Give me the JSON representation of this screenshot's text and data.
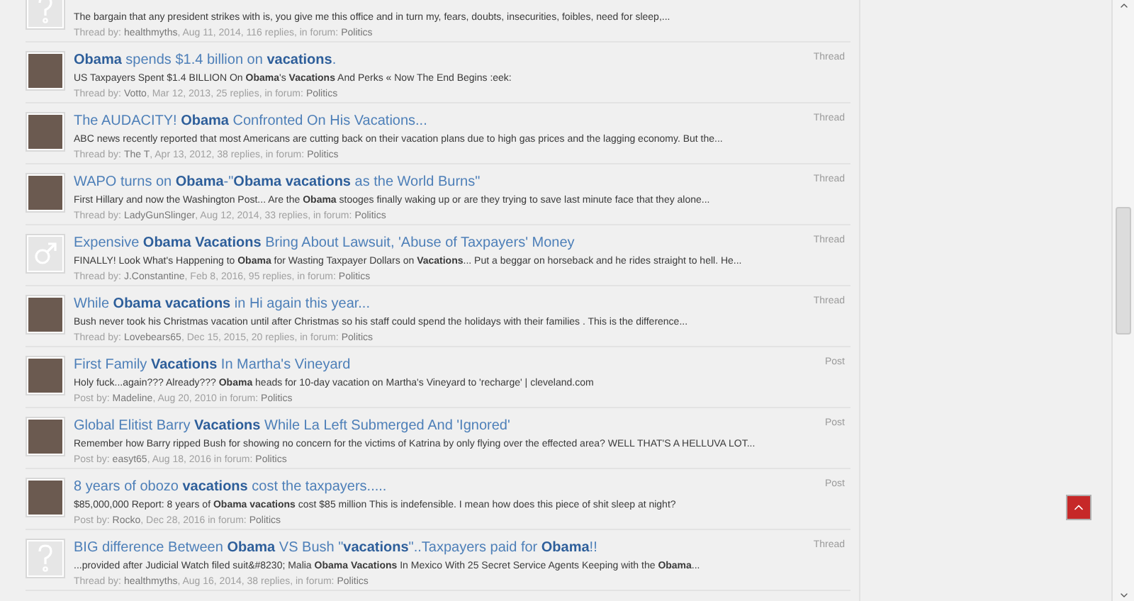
{
  "results": [
    {
      "kind": "question",
      "snippet": "The bargain that any president strikes with is, you give me this office and in turn my, fears, doubts, insecurities, foibles, need for sleep,...",
      "meta": {
        "by": "Thread by:",
        "author": "healthmyths",
        "details": ", Aug 11, 2014, 116 replies, in forum:",
        "forum": "Politics"
      }
    },
    {
      "kind": "photo",
      "type": "Thread",
      "title": "**Obama** spends $1.4 billion on **vacations**.",
      "snippet": "US Taxpayers Spent $1.4 BILLION On **Obama**'s **Vacations** And Perks « Now The End Begins :eek:",
      "meta": {
        "by": "Thread by:",
        "author": "Votto",
        "details": ", Mar 12, 2013, 25 replies, in forum:",
        "forum": "Politics"
      }
    },
    {
      "kind": "photo",
      "type": "Thread",
      "title": "The AUDACITY! **Obama** Confronted On His Vacations...",
      "snippet": "ABC news recently reported that most Americans are cutting back on their vacation plans due to high gas prices and the lagging economy. But the...",
      "meta": {
        "by": "Thread by:",
        "author": "The T",
        "details": ", Apr 13, 2012, 38 replies, in forum:",
        "forum": "Politics"
      }
    },
    {
      "kind": "photo",
      "type": "Thread",
      "title": "WAPO turns on **Obama**-\"**Obama vacations** as the World Burns\"",
      "snippet": "First Hillary and now the Washington Post... Are the **Obama** stooges finally waking up or are they trying to save last minute face that they alone...",
      "meta": {
        "by": "Thread by:",
        "author": "LadyGunSlinger",
        "details": ", Aug 12, 2014, 33 replies, in forum:",
        "forum": "Politics"
      }
    },
    {
      "kind": "male",
      "type": "Thread",
      "title": "Expensive **Obama Vacations** Bring About Lawsuit, 'Abuse of Taxpayers' Money",
      "snippet": "FINALLY! Look What's Happening to **Obama** for Wasting Taxpayer Dollars on **Vacations**... Put a beggar on horseback and he rides straight to hell. He...",
      "meta": {
        "by": "Thread by:",
        "author": "J.Constantine",
        "details": ", Feb 8, 2016, 95 replies, in forum:",
        "forum": "Politics"
      }
    },
    {
      "kind": "photo",
      "type": "Thread",
      "title": "While **Obama vacations** in Hi again this year...",
      "snippet": "Bush never took his Christmas vacation until after Christmas so his staff could spend the holidays with their families . This is the difference...",
      "meta": {
        "by": "Thread by:",
        "author": "Lovebears65",
        "details": ", Dec 15, 2015, 20 replies, in forum:",
        "forum": "Politics"
      }
    },
    {
      "kind": "photo",
      "type": "Post",
      "title": "First Family **Vacations** In Martha's Vineyard",
      "snippet": "Holy fuck...again??? Already??? **Obama** heads for 10-day vacation on Martha's Vineyard to 'recharge' | cleveland.com",
      "meta": {
        "by": "Post by:",
        "author": "Madeline",
        "details": ", Aug 20, 2010 in forum:",
        "forum": "Politics"
      }
    },
    {
      "kind": "photo",
      "type": "Post",
      "title": "Global Elitist Barry **Vacations** While La Left Submerged And 'Ignored'",
      "snippet": "Remember how Barry ripped Bush for showing no concern for the victims of Katrina by only flying over the effected area? WELL THAT'S A HELLUVA LOT...",
      "meta": {
        "by": "Post by:",
        "author": "easyt65",
        "details": ", Aug 18, 2016 in forum:",
        "forum": "Politics"
      }
    },
    {
      "kind": "photo",
      "type": "Post",
      "title": "8 years of obozo **vacations** cost the taxpayers.....",
      "snippet": "$85,000,000 Report: 8 years of **Obama vacations** cost $85 million This is indefensible. I mean how does this piece of shit sleep at night?",
      "meta": {
        "by": "Post by:",
        "author": "Rocko",
        "details": ", Dec 28, 2016 in forum:",
        "forum": "Politics"
      }
    },
    {
      "kind": "question",
      "type": "Thread",
      "title": "BIG difference Between **Obama** VS Bush \"**vacations**\"..Taxpayers paid for **Obama**!!",
      "snippet": "...provided after Judicial Watch filed suit&#8230; Malia **Obama Vacations** In Mexico With 25 Secret Service Agents Keeping with the **Obama**...",
      "meta": {
        "by": "Thread by:",
        "author": "healthmyths",
        "details": ", Aug 16, 2014, 38 replies, in forum:",
        "forum": "Politics"
      }
    }
  ]
}
